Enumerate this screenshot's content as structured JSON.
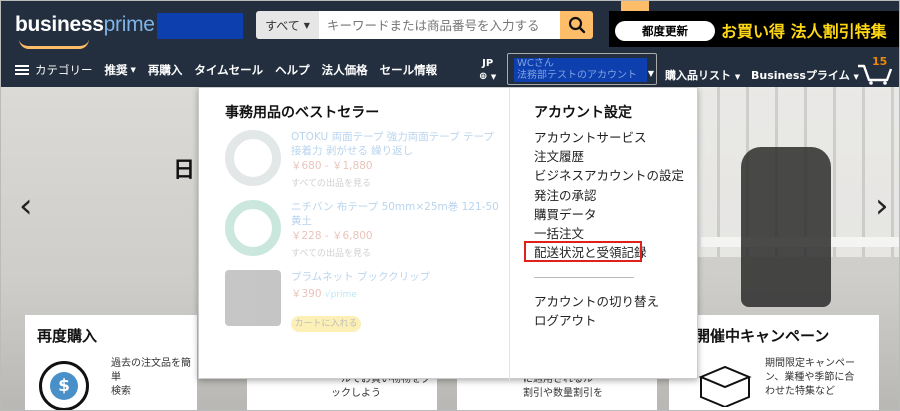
{
  "header": {
    "logo_main": "business",
    "logo_prime": "prime",
    "search": {
      "category_label": "すべて",
      "placeholder": "キーワードまたは商品番号を入力する"
    },
    "promo": {
      "pill_label": "都度更新",
      "text": "お買い得 法人割引特集"
    },
    "region": {
      "code": "JP"
    },
    "account_greeting": "WCさん",
    "account_sub": "法務部テストのアカウント",
    "lists_label": "購入品リスト",
    "business_prime_label": "Businessプライム",
    "cart_count": "15"
  },
  "nav": {
    "categories_label": "カテゴリー",
    "items": [
      "推奨",
      "再購入",
      "タイムセール",
      "ヘルプ",
      "法人価格",
      "セール情報"
    ]
  },
  "hero": {
    "title_fragment": "日",
    "cards": [
      {
        "title": "再度購入",
        "desc_1": "過去の注文品を簡単",
        "desc_2": "検索"
      },
      {
        "title": "開催中キャンペーン",
        "desc_1": "期間限定キャンペー",
        "desc_2": "ン、業種や季節に合",
        "desc_3": "わせた特集など"
      }
    ],
    "strip_texts": [
      "ールでお買い物物をグ",
      "ックしよう",
      "に適用されるルー",
      "割引や数量割引を"
    ]
  },
  "dropdown": {
    "left_title": "事務用品のベストセラー",
    "right_title": "アカウント設定",
    "bestsellers": [
      {
        "title": "OTOKU 両面テープ 強力両面テープ テープ 接着力 剥がせる 繰り返し",
        "price": "￥680 - ￥1,880",
        "sub": "すべての出品を見る"
      },
      {
        "title": "ニチバン 布テープ 50mm×25m巻 121-50 黄土",
        "price": "￥228 - ￥6,800",
        "sub": "すべての出品を見る"
      },
      {
        "title": "プラムネット ブッククリップ",
        "price": "￥390",
        "sub": "√prime",
        "button": "カートに入れる"
      }
    ],
    "account_links": [
      "アカウントサービス",
      "注文履歴",
      "ビジネスアカウントの設定",
      "発注の承認",
      "購買データ",
      "一括注文",
      "配送状況と受領記録"
    ],
    "account_links_2": [
      "アカウントの切り替え",
      "ログアウト"
    ],
    "highlight_color": "#e0201a"
  },
  "colors": {
    "header_bg": "#232f3e",
    "search_button": "#febd69",
    "promo_text": "#ffd814"
  }
}
